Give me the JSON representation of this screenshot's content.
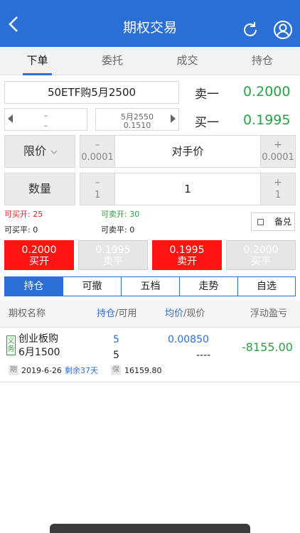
{
  "header": {
    "title": "期权交易",
    "icons": [
      "chevron-left-icon",
      "refresh-icon",
      "user-icon"
    ]
  },
  "tabs": [
    {
      "label": "下单",
      "active": true
    },
    {
      "label": "委托",
      "active": false
    },
    {
      "label": "成交",
      "active": false
    },
    {
      "label": "持仓",
      "active": false
    }
  ],
  "order": {
    "contract": "50ETF购5月2500",
    "quote_sell_label": "卖一",
    "quote_sell_value": "0.2000",
    "quote_buy_label": "买一",
    "quote_buy_value": "0.1995",
    "left_stepper_line1": "–",
    "left_stepper_line2": "–",
    "right_stepper_line1": "5月2550",
    "right_stepper_line2": "0.1510",
    "price_type_label": "限价",
    "price_minus_symbol": "–",
    "price_minus_value": "0.0001",
    "price_value": "对手价",
    "price_plus_symbol": "+",
    "price_plus_value": "0.0001",
    "qty_label": "数量",
    "qty_minus_symbol": "–",
    "qty_minus_value": "1",
    "qty_value": "1",
    "qty_plus_symbol": "+",
    "qty_plus_value": "1",
    "can_buy_open": "可买开: 25",
    "can_sell_open": "可卖开: 30",
    "can_buy_close": "可买平: 0",
    "can_sell_close": "可卖平: 0",
    "covered_label": "备兑"
  },
  "trade_buttons": [
    {
      "price": "0.2000",
      "action": "买开",
      "style": "red"
    },
    {
      "price": "0.1995",
      "action": "卖平",
      "style": "gray"
    },
    {
      "price": "0.1995",
      "action": "卖开",
      "style": "red"
    },
    {
      "price": "0.2000",
      "action": "买平",
      "style": "gray"
    }
  ],
  "segments": [
    {
      "label": "持仓",
      "active": true
    },
    {
      "label": "可撤",
      "active": false
    },
    {
      "label": "五档",
      "active": false
    },
    {
      "label": "走势",
      "active": false
    },
    {
      "label": "自选",
      "active": false
    }
  ],
  "table": {
    "col_name": "期权名称",
    "col_pos_a": "持仓",
    "col_pos_b": "/可用",
    "col_price_a": "均价",
    "col_price_b": "/现价",
    "col_pnl": "浮动盈亏",
    "rows": [
      {
        "tag_line1": "义",
        "tag_line2": "务",
        "name_line1": "创业板购",
        "name_line2": "6月1500",
        "position": "5",
        "available": "5",
        "avg_price": "0.00850",
        "cur_price": "----",
        "pnl": "-8155.00",
        "expiry_tag": "期",
        "expiry_date": "2019-6-26",
        "remaining": "剩余37天",
        "margin_tag": "保",
        "margin_value": "16159.80"
      }
    ]
  },
  "colors": {
    "primary": "#2a6fd6",
    "buy_red": "#ff1414",
    "green": "#2aa044"
  }
}
